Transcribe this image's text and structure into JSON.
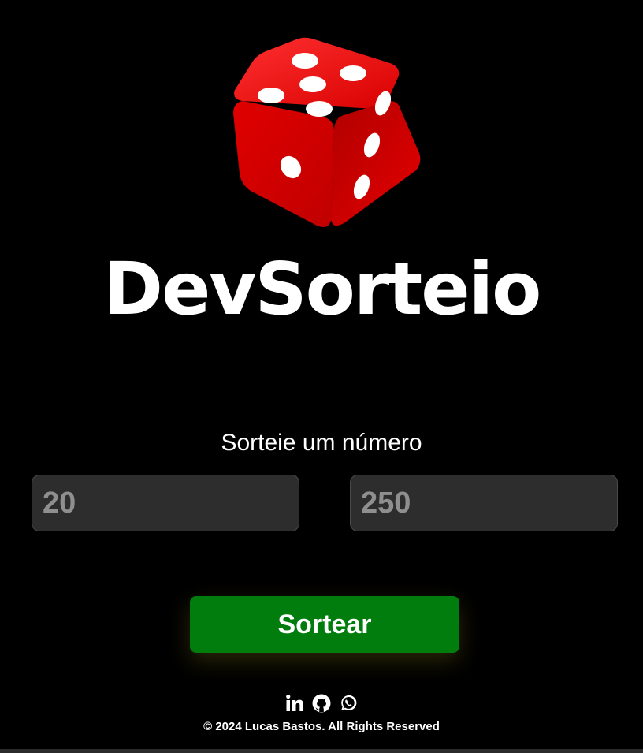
{
  "header": {
    "logo_icon": "red-dice-icon",
    "title": "DevSorteio"
  },
  "main": {
    "subtitle": "Sorteie um número",
    "min_input": {
      "placeholder": "20"
    },
    "max_input": {
      "placeholder": "250"
    },
    "draw_button_label": "Sortear"
  },
  "footer": {
    "social_icons": [
      "linkedin-icon",
      "github-icon",
      "whatsapp-icon"
    ],
    "copyright": "© 2024 Lucas Bastos. All Rights Reserved"
  },
  "colors": {
    "background": "#000000",
    "input_background": "#2d2d2d",
    "button": "#007d0c",
    "dice": "#e00000"
  }
}
